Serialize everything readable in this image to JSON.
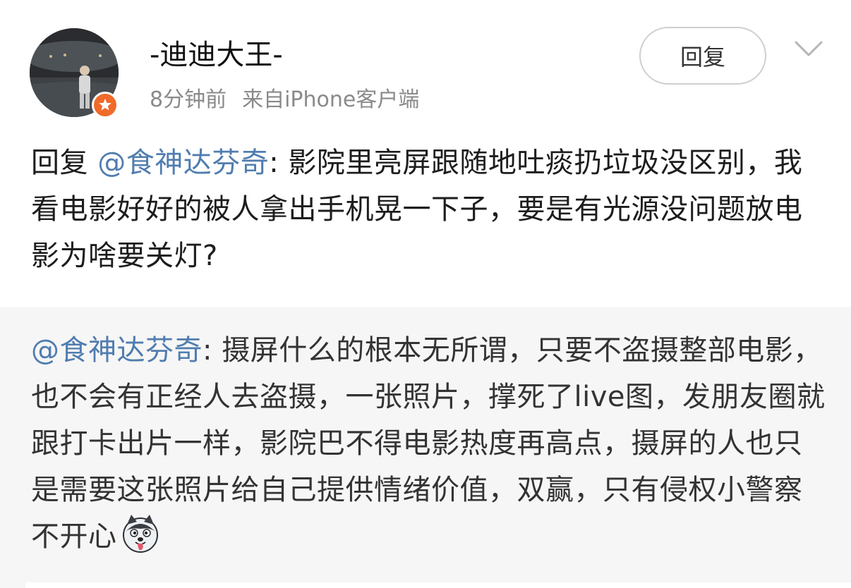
{
  "post": {
    "username": "-迪迪大王-",
    "time": "8分钟前",
    "source_prefix": "来自",
    "source": "iPhone客户端",
    "reply_button_label": "回复",
    "avatar_icon": "user-avatar-photo",
    "badge_icon": "verified-star-badge",
    "chevron_icon": "chevron-down-icon",
    "body": {
      "reply_prefix": "回复",
      "mention": "@食神达芬奇",
      "text": ": 影院里亮屏跟随地吐痰扔垃圾没区别，我看电影好好的被人拿出手机晃一下子，要是有光源没问题放电影为啥要关灯?"
    }
  },
  "quote": {
    "mention": "@食神达芬奇",
    "text": ": 摄屏什么的根本无所谓，只要不盗摄整部电影，也不会有正经人去盗摄，一张照片，撑死了live图，发朋友圈就跟打卡出片一样，影院巴不得电影热度再高点，摄屏的人也只是需要这张照片给自己提供情绪价值，双赢，只有侵权小警察不开心",
    "emoji_icon": "husky-dog-emoji"
  },
  "colors": {
    "mention": "#507daf",
    "badge": "#f06a2a",
    "quote_background": "#f6f6f6"
  }
}
